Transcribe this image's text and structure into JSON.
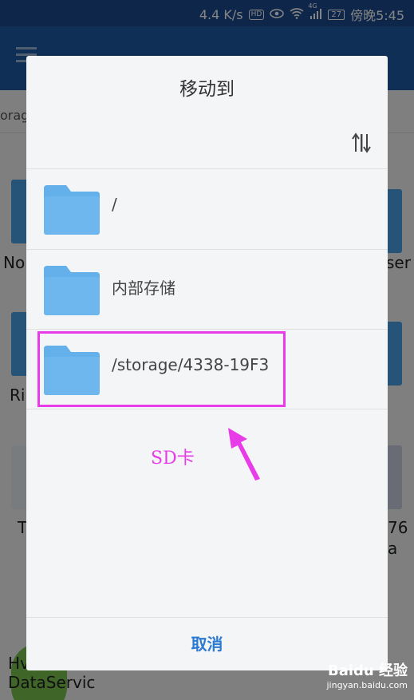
{
  "status_bar": {
    "speed": "4.4 K/s",
    "hd_badge": "HD",
    "network": "4G",
    "battery": "27",
    "time": "傍晚5:45"
  },
  "background": {
    "breadcrumb": "orag",
    "labels": [
      "No",
      "ser",
      "Ri",
      "T",
      "76",
      "a",
      "Hv",
      "DataServic"
    ]
  },
  "dialog": {
    "title": "移动到",
    "rows": [
      {
        "label": "/"
      },
      {
        "label": "内部存储"
      },
      {
        "label": "/storage/4338-19F3"
      }
    ],
    "cancel": "取消"
  },
  "annotation": {
    "text": "SD卡",
    "color": "#e83ce8"
  },
  "watermark": {
    "main": "Baidu 经验",
    "sub": "jingyan.baidu.com"
  },
  "colors": {
    "folder": "#64b0ea",
    "accent": "#2a7ad3",
    "appbar": "#1e5aa8"
  }
}
